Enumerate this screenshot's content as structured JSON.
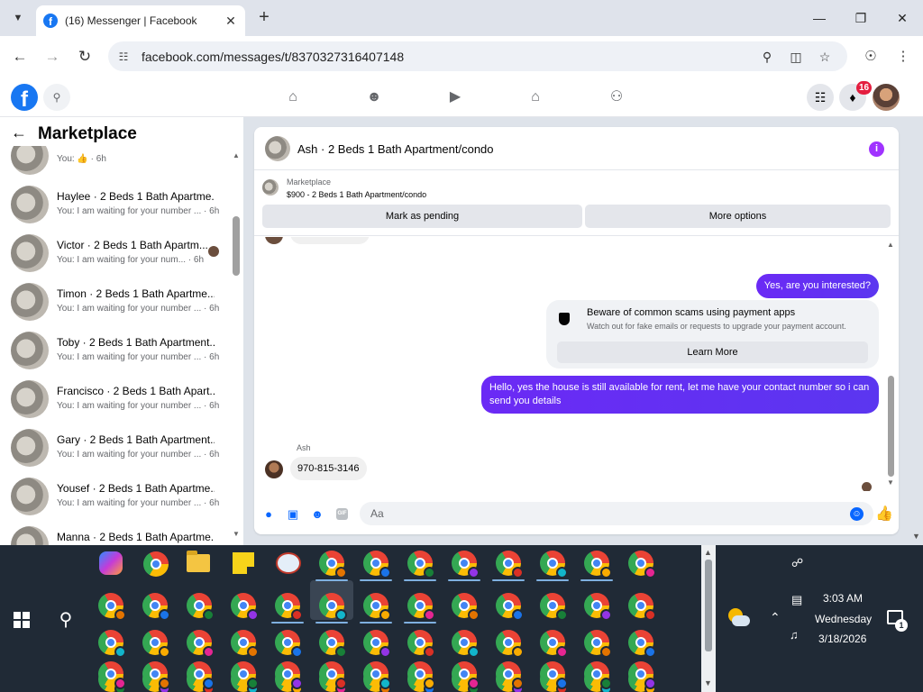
{
  "browser": {
    "tab_title": "(16) Messenger | Facebook",
    "url": "facebook.com/messages/t/8370327316407148",
    "icons": [
      "tab-list-icon",
      "facebook-favicon-icon",
      "close-icon",
      "new-tab-icon",
      "minimize-icon",
      "restore-icon",
      "window-close-icon",
      "back-icon",
      "forward-icon",
      "reload-icon",
      "site-info-icon",
      "zoom-icon",
      "install-icon",
      "bookmark-star-icon",
      "profile-icon",
      "menu-icon"
    ]
  },
  "fb_nav": {
    "logo": "f",
    "notification_count": "16",
    "icons": [
      "home-icon",
      "friends-icon",
      "video-icon",
      "marketplace-icon",
      "gaming-icon",
      "apps-grid-icon",
      "bell-icon"
    ]
  },
  "left_panel": {
    "title": "Marketplace",
    "conversations": [
      {
        "name": "",
        "snippet": "You: 👍 · 6h"
      },
      {
        "name": "Haylee · 2 Beds 1 Bath Apartme...",
        "snippet": "You: I am waiting for your number ... · 6h"
      },
      {
        "name": "Victor · 2 Beds 1 Bath Apartm...",
        "snippet": "You: I am waiting for your num... · 6h"
      },
      {
        "name": "Timon · 2 Beds 1 Bath Apartme...",
        "snippet": "You: I am waiting for your number ... · 6h"
      },
      {
        "name": "Toby · 2 Beds 1 Bath Apartment...",
        "snippet": "You: I am waiting for your number ... · 6h"
      },
      {
        "name": "Francisco · 2 Beds 1 Bath Apart...",
        "snippet": "You: I am waiting for your number ... · 6h"
      },
      {
        "name": "Gary · 2 Beds 1 Bath Apartment...",
        "snippet": "You: I am waiting for your number ... · 6h"
      },
      {
        "name": "Yousef · 2 Beds 1 Bath Apartme...",
        "snippet": "You: I am waiting for your number ... · 6h"
      },
      {
        "name": "Manna · 2 Beds 1 Bath Apartme...",
        "snippet": ""
      }
    ]
  },
  "chat": {
    "title": "Ash · 2 Beds 1 Bath Apartment/condo",
    "listing": {
      "category": "Marketplace",
      "price_title": "$900 - 2 Beds 1 Bath Apartment/condo",
      "mark_pending": "Mark as pending",
      "more_options": "More options"
    },
    "messages": {
      "out_1": "Yes, are you interested?",
      "scam_title": "Beware of common scams using payment apps",
      "scam_body": "Watch out for fake emails or requests to upgrade your payment account.",
      "learn_more": "Learn More",
      "out_2": "Hello, yes the house is still available for rent, let me have your contact number so i can send you details",
      "sender": "Ash",
      "in_1": "970-815-3146"
    },
    "composer": {
      "placeholder": "Aa",
      "gif_label": "GIF"
    },
    "colors": {
      "outgoing_bubble": "#5b36f0",
      "accent": "#0866ff",
      "info": "#a033ff"
    }
  },
  "taskbar": {
    "time": "3:03 AM",
    "day": "Wednesday",
    "date": "3/18/2026",
    "notification_count": "1"
  }
}
